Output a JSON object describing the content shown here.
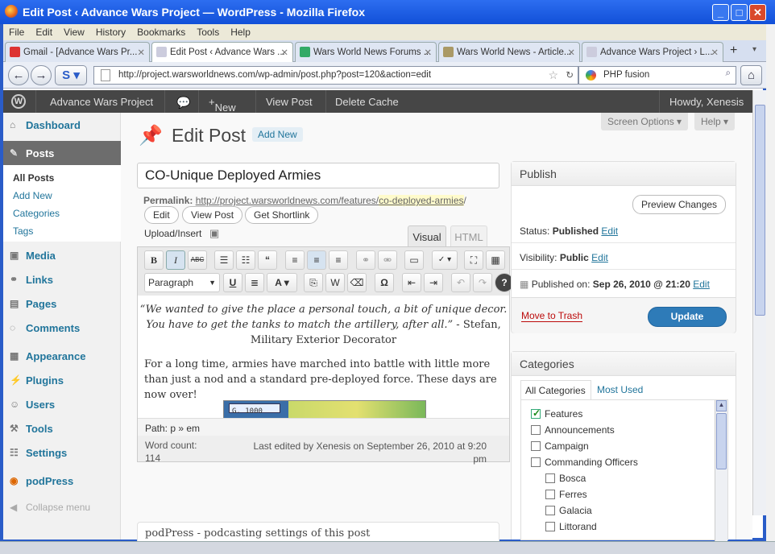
{
  "window": {
    "title": "Edit Post ‹ Advance Wars Project — WordPress - Mozilla Firefox"
  },
  "menu": [
    "File",
    "Edit",
    "View",
    "History",
    "Bookmarks",
    "Tools",
    "Help"
  ],
  "tabs": [
    {
      "label": "Gmail - [Advance Wars Pr...",
      "active": false
    },
    {
      "label": "Edit Post ‹ Advance Wars ...",
      "active": true
    },
    {
      "label": "Wars World News Forums ...",
      "active": false
    },
    {
      "label": "Wars World News - Article...",
      "active": false
    },
    {
      "label": "Advance Wars Project › L...",
      "active": false
    }
  ],
  "nav": {
    "url": "http://project.warsworldnews.com/wp-admin/post.php?post=120&action=edit",
    "search": "PHP fusion"
  },
  "adminbar": {
    "site": "Advance Wars Project",
    "new": "New",
    "view_post": "View Post",
    "delete_cache": "Delete Cache",
    "howdy": "Howdy, Xenesis"
  },
  "sidebar": {
    "dashboard": "Dashboard",
    "posts": "Posts",
    "posts_sub": [
      "All Posts",
      "Add New",
      "Categories",
      "Tags"
    ],
    "media": "Media",
    "links": "Links",
    "pages": "Pages",
    "comments": "Comments",
    "appearance": "Appearance",
    "plugins": "Plugins",
    "users": "Users",
    "tools": "Tools",
    "settings": "Settings",
    "podpress": "podPress",
    "collapse": "Collapse menu"
  },
  "page": {
    "title": "Edit Post",
    "add_new": "Add New",
    "screen_options": "Screen Options",
    "help": "Help",
    "post_title": "CO-Unique Deployed Armies",
    "permalink_label": "Permalink:",
    "permalink_base": "http://project.warsworldnews.com/features/",
    "permalink_slug": "co-deployed-armies",
    "permalink_end": "/",
    "btn_edit": "Edit",
    "btn_view_post": "View Post",
    "btn_shortlink": "Get Shortlink",
    "upload_insert": "Upload/Insert",
    "tab_visual": "Visual",
    "tab_html": "HTML",
    "format_select": "Paragraph",
    "content_quote": "“We wanted to give the place a personal touch, a bit of unique decor. You have to get the tanks to match the artillery, after all.”",
    "content_quote_attr": " - Stefan, Military Exterior Decorator",
    "content_para": "For a long time, armies have marched into battle with little more than just a nod and a standard pre-deployed force. These days are now over!",
    "img_text": "G.  1000",
    "path": "Path: p » em",
    "word_count_label": "Word count:",
    "word_count": "114",
    "last_edited": "Last edited by Xenesis on September 26, 2010 at 9:20 pm",
    "podpress_box": "podPress - podcasting settings of this post"
  },
  "publish": {
    "heading": "Publish",
    "preview": "Preview Changes",
    "status_label": "Status:",
    "status": "Published",
    "edit": "Edit",
    "visibility_label": "Visibility:",
    "visibility": "Public",
    "published_on_label": "Published on:",
    "published_on": "Sep 26, 2010 @ 21:20",
    "trash": "Move to Trash",
    "update": "Update"
  },
  "categories": {
    "heading": "Categories",
    "tab_all": "All Categories",
    "tab_used": "Most Used",
    "items": [
      {
        "label": "Features",
        "checked": true,
        "level": 0
      },
      {
        "label": "Announcements",
        "checked": false,
        "level": 0
      },
      {
        "label": "Campaign",
        "checked": false,
        "level": 0
      },
      {
        "label": "Commanding Officers",
        "checked": false,
        "level": 0
      },
      {
        "label": "Bosca",
        "checked": false,
        "level": 1
      },
      {
        "label": "Ferres",
        "checked": false,
        "level": 1
      },
      {
        "label": "Galacia",
        "checked": false,
        "level": 1
      },
      {
        "label": "Littorand",
        "checked": false,
        "level": 1
      }
    ]
  },
  "colors": {
    "link": "#21759b",
    "adminbar": "#464646",
    "update_button": "#2e7bb8",
    "titlebar": "#1150d8"
  }
}
